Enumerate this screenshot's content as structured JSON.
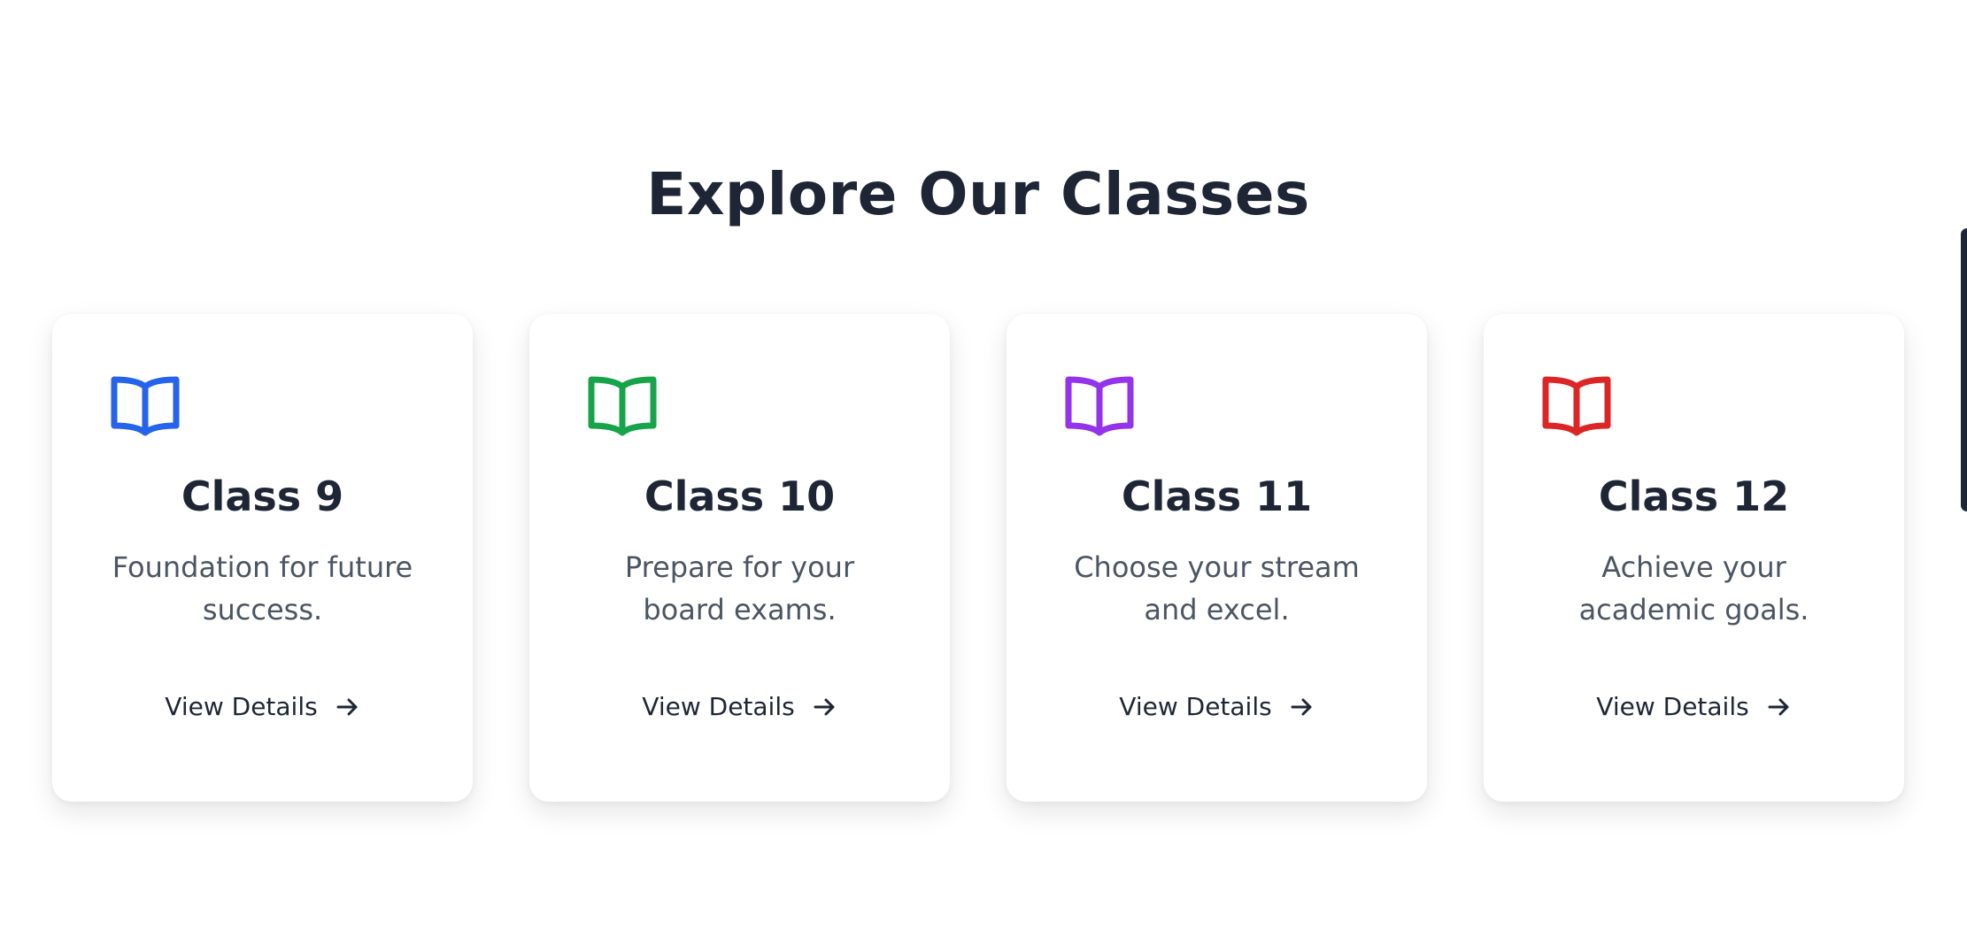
{
  "section": {
    "title": "Explore Our Classes"
  },
  "cards": [
    {
      "icon": "open-book-icon",
      "icon_color": "#2563eb",
      "title": "Class 9",
      "description": "Foundation for future success.",
      "link_label": "View Details"
    },
    {
      "icon": "open-book-icon",
      "icon_color": "#16a34a",
      "title": "Class 10",
      "description": "Prepare for your board exams.",
      "link_label": "View Details"
    },
    {
      "icon": "open-book-icon",
      "icon_color": "#9333ea",
      "title": "Class 11",
      "description": "Choose your stream and excel.",
      "link_label": "View Details"
    },
    {
      "icon": "open-book-icon",
      "icon_color": "#dc2626",
      "title": "Class 12",
      "description": "Achieve your academic goals.",
      "link_label": "View Details"
    }
  ],
  "colors": {
    "heading": "#1e2636",
    "body_text": "#4b5563",
    "card_background": "#ffffff",
    "page_background": "#ffffff"
  }
}
